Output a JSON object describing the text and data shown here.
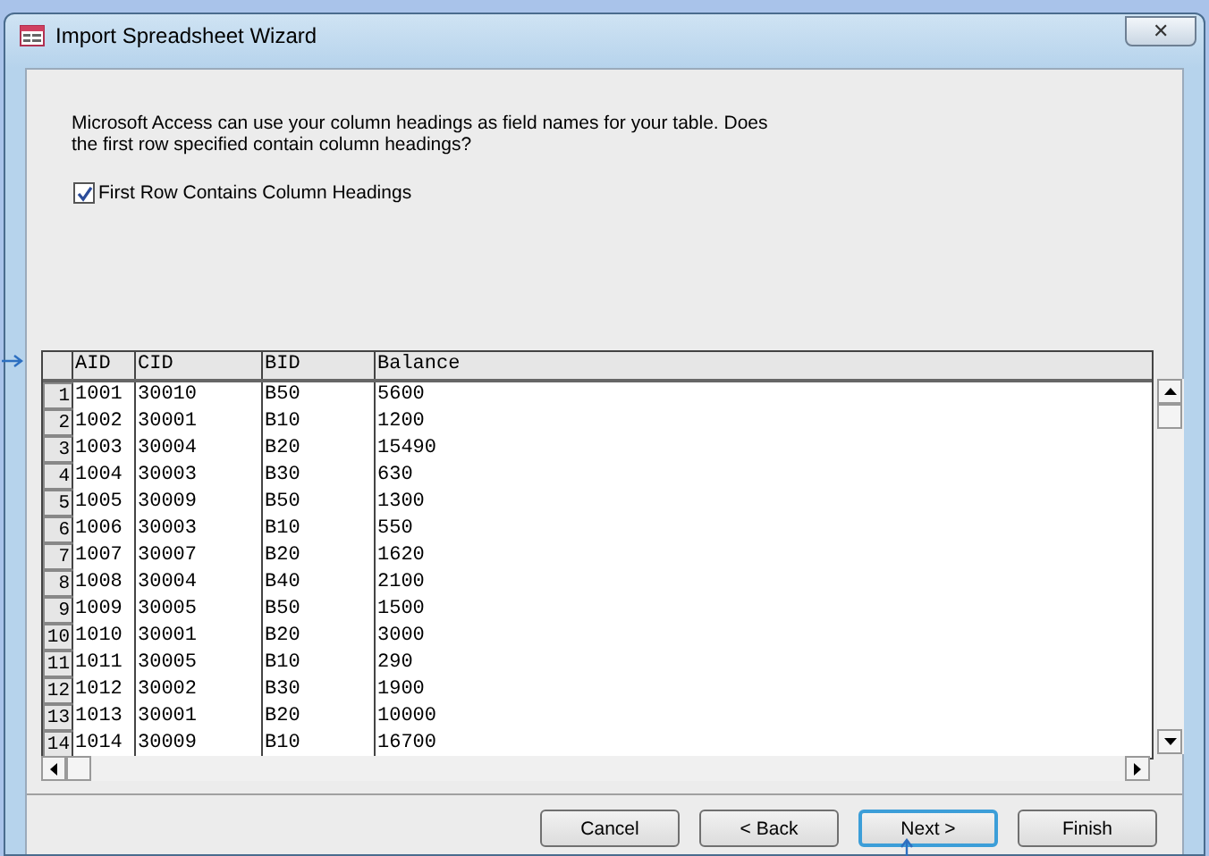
{
  "window": {
    "title": "Import Spreadsheet Wizard",
    "close": "✕"
  },
  "prompt": "Microsoft Access can use your column headings as field names for your table. Does the first row specified contain column headings?",
  "checkbox": {
    "label": "First Row Contains Column Headings",
    "checked": true
  },
  "table": {
    "columns": [
      "AID",
      "CID",
      "BID",
      "Balance"
    ],
    "rows": [
      {
        "num": "1",
        "cells": [
          "1001",
          "30010",
          "B50",
          "5600"
        ]
      },
      {
        "num": "2",
        "cells": [
          "1002",
          "30001",
          "B10",
          "1200"
        ]
      },
      {
        "num": "3",
        "cells": [
          "1003",
          "30004",
          "B20",
          "15490"
        ]
      },
      {
        "num": "4",
        "cells": [
          "1004",
          "30003",
          "B30",
          "630"
        ]
      },
      {
        "num": "5",
        "cells": [
          "1005",
          "30009",
          "B50",
          "1300"
        ]
      },
      {
        "num": "6",
        "cells": [
          "1006",
          "30003",
          "B10",
          "550"
        ]
      },
      {
        "num": "7",
        "cells": [
          "1007",
          "30007",
          "B20",
          "1620"
        ]
      },
      {
        "num": "8",
        "cells": [
          "1008",
          "30004",
          "B40",
          "2100"
        ]
      },
      {
        "num": "9",
        "cells": [
          "1009",
          "30005",
          "B50",
          "1500"
        ]
      },
      {
        "num": "10",
        "cells": [
          "1010",
          "30001",
          "B20",
          "3000"
        ]
      },
      {
        "num": "11",
        "cells": [
          "1011",
          "30005",
          "B10",
          "290"
        ]
      },
      {
        "num": "12",
        "cells": [
          "1012",
          "30002",
          "B30",
          "1900"
        ]
      },
      {
        "num": "13",
        "cells": [
          "1013",
          "30001",
          "B20",
          "10000"
        ]
      },
      {
        "num": "14",
        "cells": [
          "1014",
          "30009",
          "B10",
          "16700"
        ]
      }
    ]
  },
  "buttons": [
    {
      "label": "Cancel",
      "focused": false
    },
    {
      "label": "< Back",
      "focused": false
    },
    {
      "label": "Next >",
      "focused": true
    },
    {
      "label": "Finish",
      "focused": false
    }
  ]
}
